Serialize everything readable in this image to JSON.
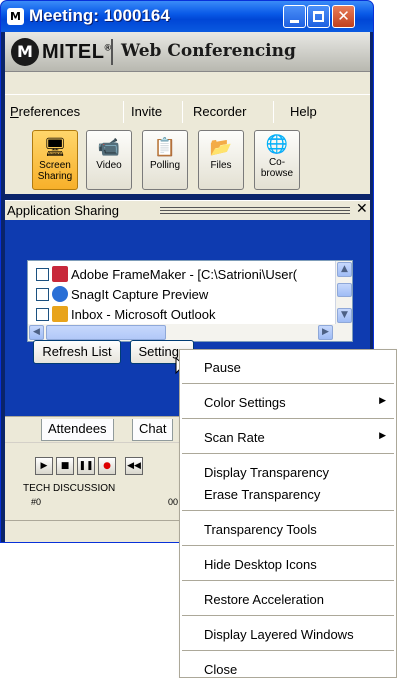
{
  "window": {
    "title": "Meeting: 1000164",
    "app_icon_text": "M"
  },
  "banner": {
    "brand": "MITEL",
    "trademark": "®",
    "product": "Web Conferencing",
    "logo_glyph": "M"
  },
  "menu": [
    "Preferences",
    "Invite",
    "Recorder",
    "Help"
  ],
  "toolbar": [
    {
      "label_line1": "Screen",
      "label_line2": "Sharing",
      "icon": "monitor-icon",
      "active": true
    },
    {
      "label_line1": "Video",
      "label_line2": "",
      "icon": "camera-icon",
      "active": false
    },
    {
      "label_line1": "Polling",
      "label_line2": "",
      "icon": "poll-icon",
      "active": false
    },
    {
      "label_line1": "Files",
      "label_line2": "",
      "icon": "files-icon",
      "active": false
    },
    {
      "label_line1": "Co-",
      "label_line2": "browse",
      "icon": "globe-icon",
      "active": false
    }
  ],
  "app_sharing": {
    "title": "Application Sharing",
    "items": [
      {
        "label": "Adobe FrameMaker - [C:\\Satrioni\\User(",
        "icon": "framemaker-icon",
        "color": "#c8283a"
      },
      {
        "label": "SnagIt Capture Preview",
        "icon": "snagit-icon",
        "color": "#2a6fd6"
      },
      {
        "label": "Inbox - Microsoft Outlook",
        "icon": "outlook-icon",
        "color": "#e8a41c"
      }
    ],
    "refresh_label": "Refresh List",
    "settings_label": "Settings"
  },
  "tabs": [
    "Attendees",
    "Chat"
  ],
  "media": {
    "label": "TECH DISCUSSION",
    "track_num": "#0",
    "time_partial": "00"
  },
  "context_menu": {
    "items": [
      {
        "label": "Pause",
        "submenu": false
      },
      {
        "label": "Color Settings",
        "submenu": true
      },
      {
        "label": "Scan Rate",
        "submenu": true
      },
      {
        "label": "Display Transparency",
        "submenu": false
      },
      {
        "label": "Erase Transparency",
        "submenu": false
      },
      {
        "label": "Transparency Tools",
        "submenu": false
      },
      {
        "label": "Hide Desktop Icons",
        "submenu": false
      },
      {
        "label": "Restore Acceleration",
        "submenu": false
      },
      {
        "label": "Display Layered Windows",
        "submenu": false
      },
      {
        "label": "Close",
        "submenu": false
      }
    ]
  },
  "colors": {
    "titlebar": "#0a5be8",
    "panel_blue": "#0e3bb0",
    "active_tool": "#f7b02a"
  }
}
